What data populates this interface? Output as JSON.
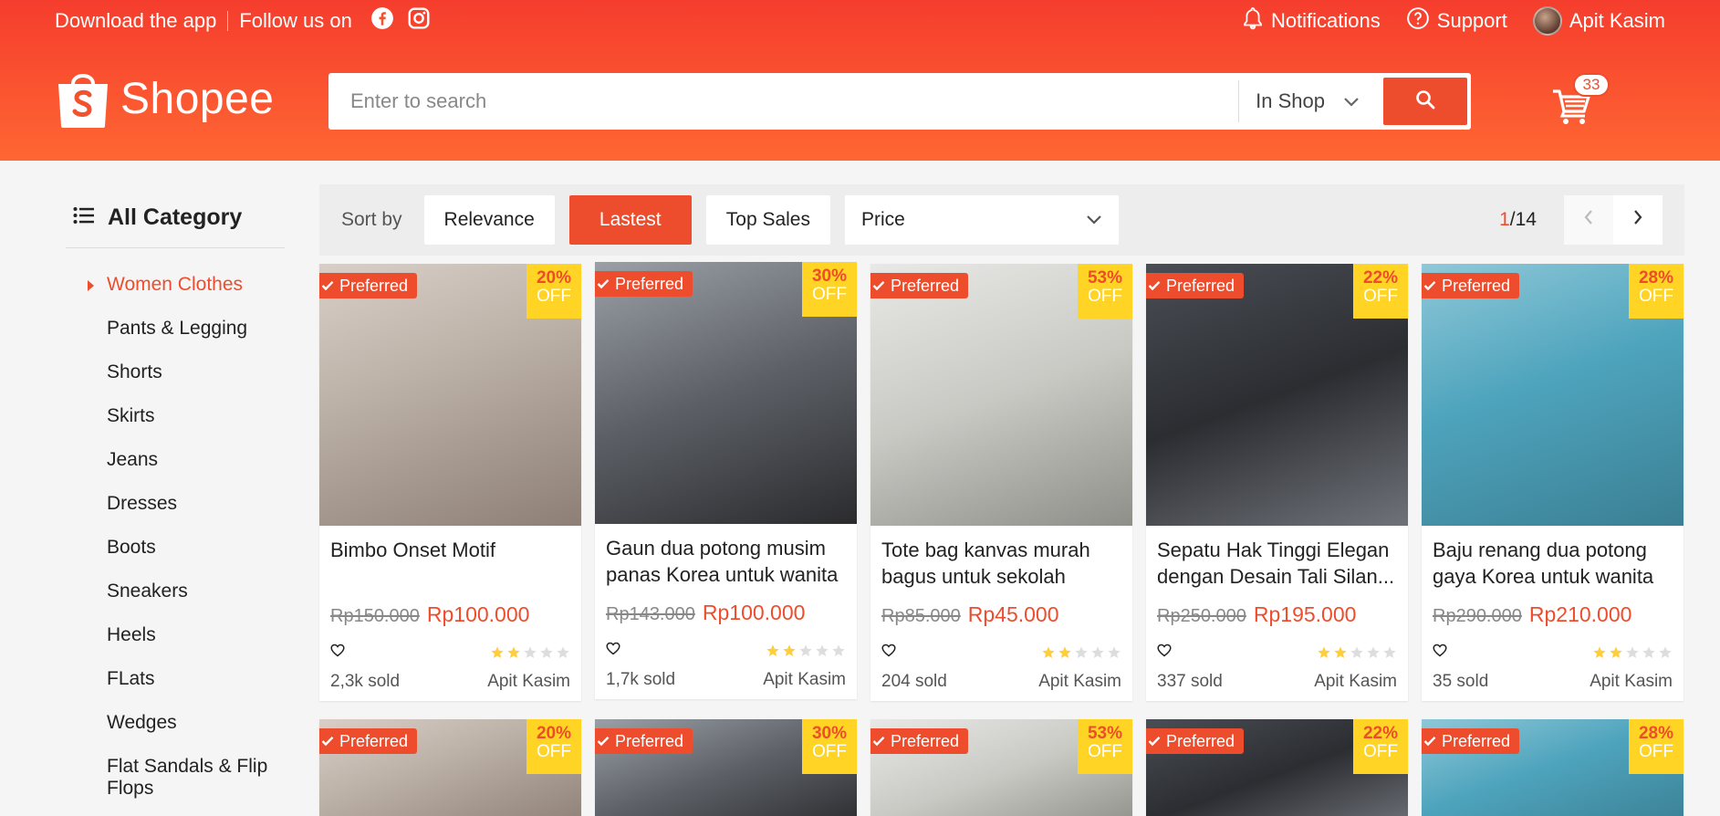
{
  "topbar": {
    "download": "Download the app",
    "follow": "Follow us on",
    "notifications": "Notifications",
    "support": "Support",
    "user": "Apit Kasim"
  },
  "brand": {
    "name": "Shopee",
    "color": "#ee4d2d"
  },
  "search": {
    "placeholder": "Enter to search",
    "scope": "In Shop"
  },
  "cart": {
    "count": "33"
  },
  "sidebar": {
    "title": "All Category",
    "items": [
      {
        "label": "Women Clothes"
      },
      {
        "label": "Pants & Legging"
      },
      {
        "label": "Shorts"
      },
      {
        "label": "Skirts"
      },
      {
        "label": "Jeans"
      },
      {
        "label": "Dresses"
      },
      {
        "label": "Boots"
      },
      {
        "label": "Sneakers"
      },
      {
        "label": "Heels"
      },
      {
        "label": "FLats"
      },
      {
        "label": "Wedges"
      },
      {
        "label": "Flat Sandals & Flip Flops"
      }
    ]
  },
  "sort": {
    "label": "Sort by",
    "relevance": "Relevance",
    "latest": "Lastest",
    "top_sales": "Top Sales",
    "price": "Price",
    "page_current": "1",
    "page_total": "/14"
  },
  "products": [
    {
      "badge": "Preferred",
      "discount": "20%",
      "off": "OFF",
      "name": "Bimbo Onset Motif",
      "old_price": "Rp150.000",
      "price": "Rp100.000",
      "rating": 2,
      "sold": "2,3k sold",
      "seller": "Apit Kasim"
    },
    {
      "badge": "Preferred",
      "discount": "30%",
      "off": "OFF",
      "name": "Gaun dua potong musim panas Korea untuk wanita",
      "old_price": "Rp143.000",
      "price": "Rp100.000",
      "rating": 2,
      "sold": "1,7k sold",
      "seller": "Apit Kasim"
    },
    {
      "badge": "Preferred",
      "discount": "53%",
      "off": "OFF",
      "name": "Tote bag kanvas murah bagus untuk sekolah",
      "old_price": "Rp85.000",
      "price": "Rp45.000",
      "rating": 2,
      "sold": "204 sold",
      "seller": "Apit Kasim"
    },
    {
      "badge": "Preferred",
      "discount": "22%",
      "off": "OFF",
      "name": "Sepatu Hak Tinggi Elegan dengan Desain Tali Silan...",
      "old_price": "Rp250.000",
      "price": "Rp195.000",
      "rating": 2,
      "sold": "337 sold",
      "seller": "Apit Kasim"
    },
    {
      "badge": "Preferred",
      "discount": "28%",
      "off": "OFF",
      "name": "Baju renang dua potong gaya Korea untuk wanita",
      "old_price": "Rp290.000",
      "price": "Rp210.000",
      "rating": 2,
      "sold": "35 sold",
      "seller": "Apit Kasim"
    }
  ],
  "products_row2": [
    {
      "badge": "Preferred",
      "discount": "20%",
      "off": "OFF"
    },
    {
      "badge": "Preferred",
      "discount": "30%",
      "off": "OFF"
    },
    {
      "badge": "Preferred",
      "discount": "53%",
      "off": "OFF"
    },
    {
      "badge": "Preferred",
      "discount": "22%",
      "off": "OFF"
    },
    {
      "badge": "Preferred",
      "discount": "28%",
      "off": "OFF"
    }
  ]
}
